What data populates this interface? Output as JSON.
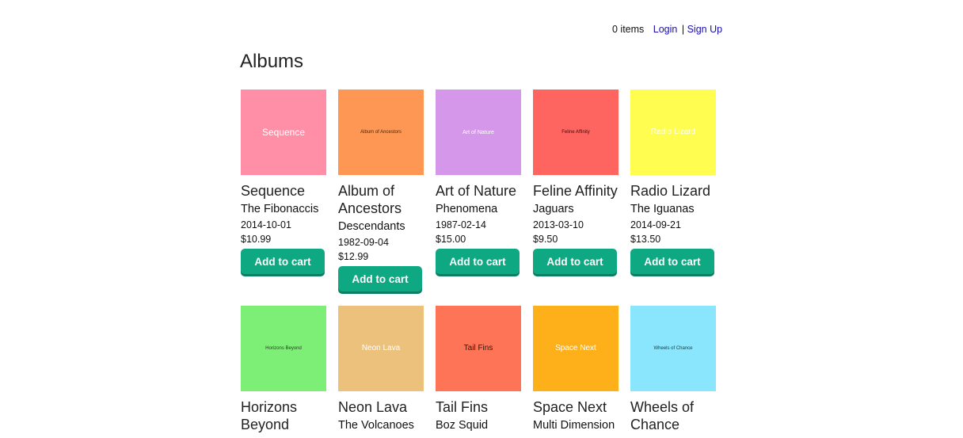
{
  "header": {
    "cart_count": "0 items",
    "login": "Login",
    "separator": "|",
    "signup": "Sign Up"
  },
  "page_title": "Albums",
  "albums": [
    {
      "cover_text": "Sequence",
      "cover_color": "#ff8fa6",
      "cover_text_color": "#ffffff",
      "title": "Sequence",
      "artist": "The Fibonaccis",
      "date": "2014-10-01",
      "price": "$10.99",
      "button": "Add to cart"
    },
    {
      "cover_text": "Album of Ancestors",
      "cover_color": "#fe9654",
      "cover_text_color": "#4a2a10",
      "title": "Album of Ancestors",
      "artist": "Descendants",
      "date": "1982-09-04",
      "price": "$12.99",
      "button": "Add to cart"
    },
    {
      "cover_text": "Art of Nature",
      "cover_color": "#d597e9",
      "cover_text_color": "#ffffff",
      "title": "Art of Nature",
      "artist": "Phenomena",
      "date": "1987-02-14",
      "price": "$15.00",
      "button": "Add to cart"
    },
    {
      "cover_text": "Feline Affinity",
      "cover_color": "#ff6560",
      "cover_text_color": "#3b1010",
      "title": "Feline Affinity",
      "artist": "Jaguars",
      "date": "2013-03-10",
      "price": "$9.50",
      "button": "Add to cart"
    },
    {
      "cover_text": "Radio Lizard",
      "cover_color": "#fefd50",
      "cover_text_color": "#ffffff",
      "title": "Radio Lizard",
      "artist": "The Iguanas",
      "date": "2014-09-21",
      "price": "$13.50",
      "button": "Add to cart"
    },
    {
      "cover_text": "Horizons Beyond",
      "cover_color": "#7def77",
      "cover_text_color": "#1f3d1d",
      "title": "Horizons Beyond",
      "artist": "",
      "date": "",
      "price": "",
      "button": ""
    },
    {
      "cover_text": "Neon Lava",
      "cover_color": "#ecc17c",
      "cover_text_color": "#ffffff",
      "title": "Neon Lava",
      "artist": "The Volcanoes",
      "date": "",
      "price": "",
      "button": ""
    },
    {
      "cover_text": "Tail Fins",
      "cover_color": "#fe7456",
      "cover_text_color": "#3a1208",
      "title": "Tail Fins",
      "artist": "Boz Squid",
      "date": "",
      "price": "",
      "button": ""
    },
    {
      "cover_text": "Space Next",
      "cover_color": "#feb01a",
      "cover_text_color": "#ffffff",
      "title": "Space Next",
      "artist": "Multi Dimension",
      "date": "",
      "price": "",
      "button": ""
    },
    {
      "cover_text": "Wheels of Chance",
      "cover_color": "#89e6fc",
      "cover_text_color": "#1a3a48",
      "title": "Wheels of Chance",
      "artist": "",
      "date": "",
      "price": "",
      "button": ""
    }
  ]
}
